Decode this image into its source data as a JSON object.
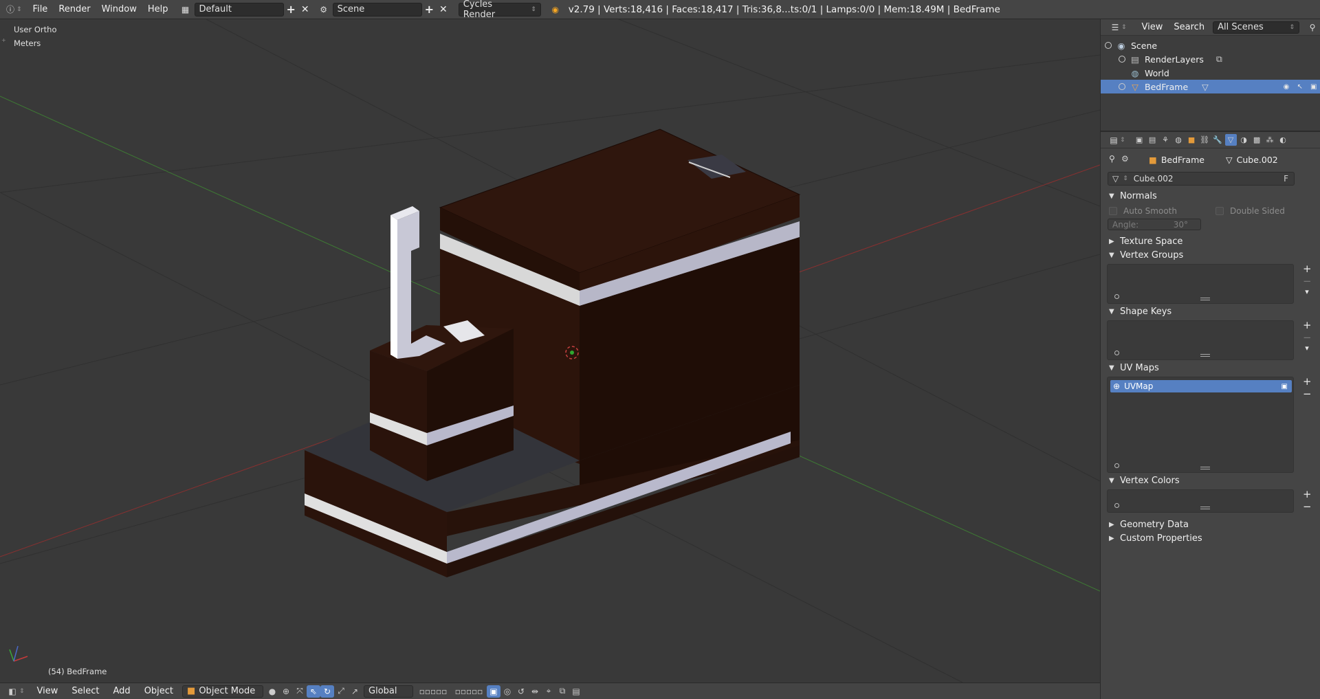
{
  "topbar": {
    "menus": [
      "File",
      "Render",
      "Window",
      "Help"
    ],
    "layout": "Default",
    "scene": "Scene",
    "engine": "Cycles Render",
    "stats": "v2.79 | Verts:18,416 | Faces:18,417 | Tris:36,8...ts:0/1 | Lamps:0/0 | Mem:18.49M | BedFrame"
  },
  "viewport": {
    "view_name": "User Ortho",
    "units": "Meters",
    "object_label": "(54) BedFrame"
  },
  "vp_header": {
    "menus": [
      "View",
      "Select",
      "Add",
      "Object"
    ],
    "mode": "Object Mode",
    "orientation": "Global"
  },
  "outliner": {
    "menus": [
      "View",
      "Search"
    ],
    "filter": "All Scenes",
    "items": [
      "Scene",
      "RenderLayers",
      "World",
      "BedFrame"
    ]
  },
  "properties": {
    "breadcrumb_object": "BedFrame",
    "breadcrumb_mesh": "Cube.002",
    "mesh_name": "Cube.002",
    "fake_user": "F",
    "panels": {
      "normals": "Normals",
      "auto_smooth": "Auto Smooth",
      "double_sided": "Double Sided",
      "angle_label": "Angle:",
      "angle_value": "30°",
      "texture_space": "Texture Space",
      "vertex_groups": "Vertex Groups",
      "shape_keys": "Shape Keys",
      "uv_maps": "UV Maps",
      "uv_item": "UVMap",
      "vertex_colors": "Vertex Colors",
      "geometry_data": "Geometry Data",
      "custom_properties": "Custom Properties"
    }
  },
  "colors": {
    "accent": "#5680c2",
    "viewport_bg": "#393939",
    "wood": "#2a130b",
    "x_axis": "#a33",
    "y_axis": "#4a8a3a"
  }
}
